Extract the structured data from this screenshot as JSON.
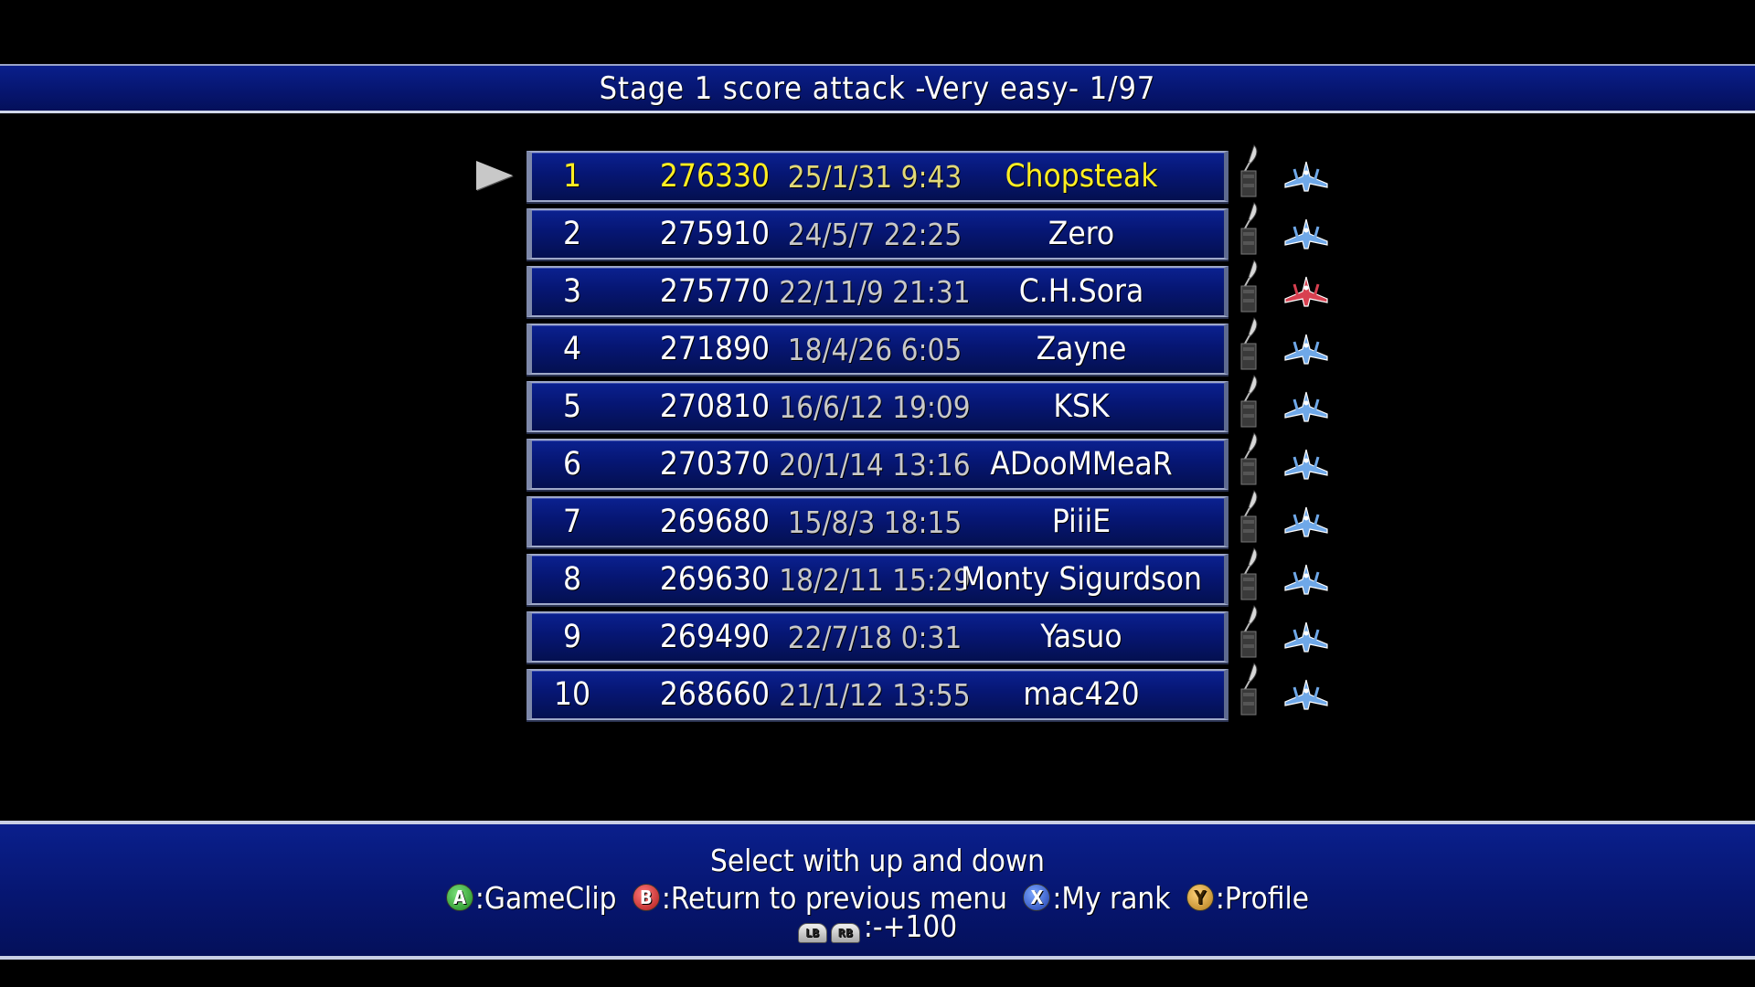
{
  "header": {
    "title": "Stage 1 score attack -Very easy- 1/97"
  },
  "leaderboard": {
    "selected_index": 0,
    "rows": [
      {
        "rank": "1",
        "score": "276330",
        "date": "25/1/31  9:43",
        "name": "Chopsteak",
        "ship_color": "blue"
      },
      {
        "rank": "2",
        "score": "275910",
        "date": "24/5/7  22:25",
        "name": "Zero",
        "ship_color": "blue"
      },
      {
        "rank": "3",
        "score": "275770",
        "date": "22/11/9  21:31",
        "name": "C.H.Sora",
        "ship_color": "red"
      },
      {
        "rank": "4",
        "score": "271890",
        "date": "18/4/26  6:05",
        "name": "Zayne",
        "ship_color": "blue"
      },
      {
        "rank": "5",
        "score": "270810",
        "date": "16/6/12  19:09",
        "name": "KSK",
        "ship_color": "blue"
      },
      {
        "rank": "6",
        "score": "270370",
        "date": "20/1/14  13:16",
        "name": "ADooMMeaR",
        "ship_color": "blue"
      },
      {
        "rank": "7",
        "score": "269680",
        "date": "15/8/3  18:15",
        "name": "PiiiE",
        "ship_color": "blue"
      },
      {
        "rank": "8",
        "score": "269630",
        "date": "18/2/11  15:29",
        "name": "Monty Sigurdson",
        "ship_color": "blue"
      },
      {
        "rank": "9",
        "score": "269490",
        "date": "22/7/18  0:31",
        "name": "Yasuo",
        "ship_color": "blue"
      },
      {
        "rank": "10",
        "score": "268660",
        "date": "21/1/12  13:55",
        "name": "mac420",
        "ship_color": "blue"
      }
    ]
  },
  "footer": {
    "instruction": "Select with up and down",
    "hints": [
      {
        "button": "A",
        "label": ":GameClip"
      },
      {
        "button": "B",
        "label": ":Return to previous menu"
      },
      {
        "button": "X",
        "label": ":My rank"
      },
      {
        "button": "Y",
        "label": ":Profile"
      }
    ],
    "bumpers": {
      "left": "LB",
      "right": "RB",
      "label": ":-+100"
    }
  },
  "colors": {
    "bar_blue": "#06156e",
    "highlight_yellow": "#ffee22",
    "date_gray": "#c8c8c8",
    "ship_blue": "#6fa8e8",
    "ship_red": "#d84050"
  }
}
